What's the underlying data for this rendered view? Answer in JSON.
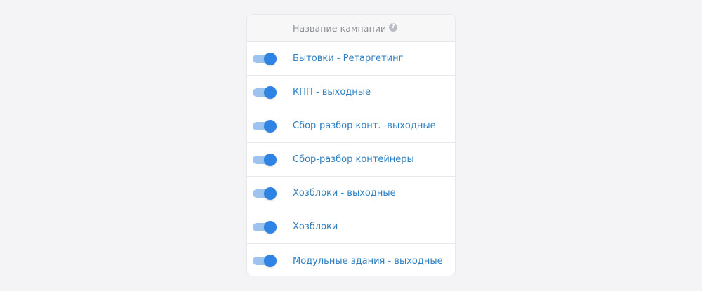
{
  "table": {
    "header": {
      "column_label": "Название кампании",
      "help_icon": "question-icon",
      "help_glyph": "?"
    },
    "rows": [
      {
        "name": "Бытовки - Ретаргетинг",
        "enabled": true
      },
      {
        "name": "КПП - выходные",
        "enabled": true
      },
      {
        "name": "Сбор-разбор конт. -выходные",
        "enabled": true
      },
      {
        "name": "Сбор-разбор контейнеры",
        "enabled": true
      },
      {
        "name": "Хозблоки - выходные",
        "enabled": true
      },
      {
        "name": "Хозблоки",
        "enabled": true
      },
      {
        "name": "Модульные здания - выходные",
        "enabled": true
      }
    ]
  },
  "colors": {
    "page_background": "#f4f4f6",
    "toggle_on": "#2f83e3",
    "toggle_track_on": "#9dc4ef",
    "link": "#2f7fc1"
  }
}
